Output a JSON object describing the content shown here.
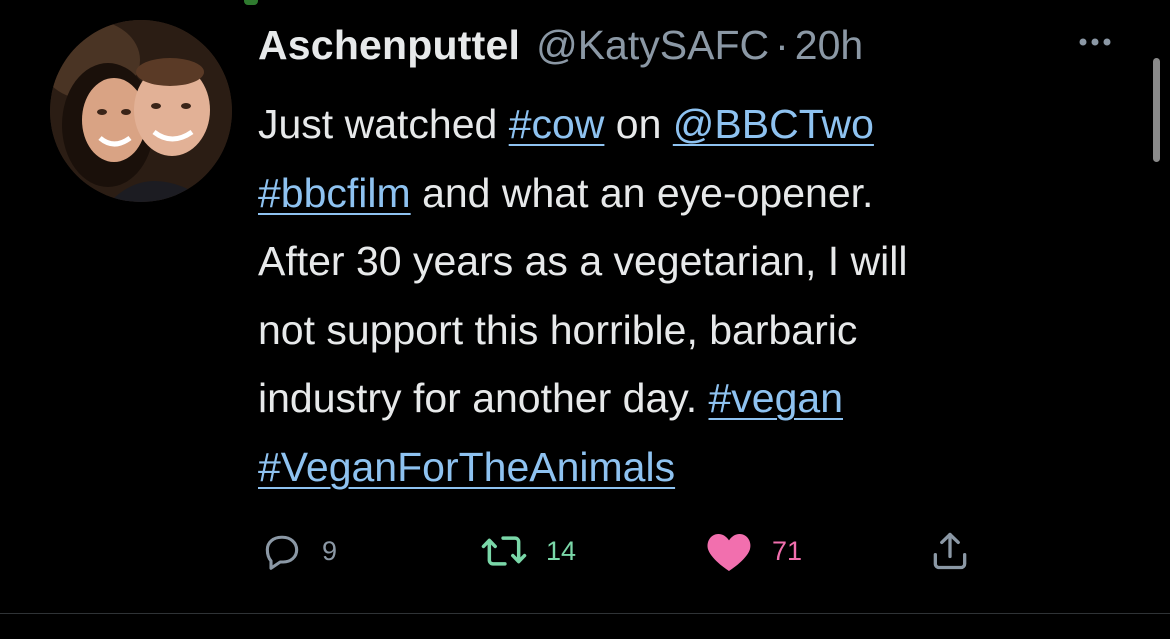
{
  "tweet": {
    "display_name": "Aschenputtel",
    "handle": "@KatySAFC",
    "separator": "·",
    "time": "20h",
    "lines": [
      [
        {
          "t": "Just watched "
        },
        {
          "t": "#cow",
          "link": true
        },
        {
          "t": " on "
        },
        {
          "t": "@BBCTwo",
          "link": true
        }
      ],
      [
        {
          "t": "#bbcfilm",
          "link": true
        },
        {
          "t": " and what an eye-opener."
        }
      ],
      [
        {
          "t": "After 30 years as a vegetarian, I will"
        }
      ],
      [
        {
          "t": "not support this horrible, barbaric"
        }
      ],
      [
        {
          "t": "industry for another day. "
        },
        {
          "t": "#vegan",
          "link": true
        }
      ],
      [
        {
          "t": "#VeganForTheAnimals",
          "link": true
        }
      ]
    ]
  },
  "actions": {
    "reply_count": "9",
    "retweet_count": "14",
    "like_count": "71"
  },
  "icons": {
    "more": "more-horizontal-icon",
    "reply": "reply-bubble-icon",
    "retweet": "retweet-icon",
    "like": "heart-icon",
    "share": "share-icon"
  },
  "colors": {
    "background": "#000000",
    "text": "#e7e9ea",
    "secondary": "#8b98a5",
    "link": "#8ec2f0",
    "retweet": "#7ad7a8",
    "like": "#f26fae"
  }
}
